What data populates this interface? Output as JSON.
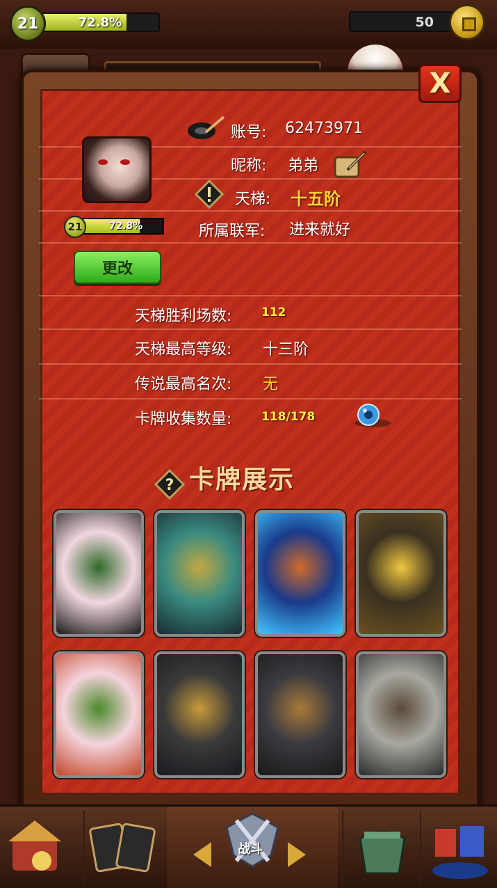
{
  "hud": {
    "level": "21",
    "xp_percent_text": "72.8%",
    "xp_fraction": 0.728,
    "coins": "50"
  },
  "profile": {
    "account_label": "账号:",
    "account_value": "62473971",
    "nickname_label": "昵称:",
    "nickname_value": "弟弟",
    "ladder_label": "天梯:",
    "ladder_value": "十五阶",
    "alliance_label": "所属联军:",
    "alliance_value": "进来就好",
    "level": "21",
    "xp_percent_text": "72.8%",
    "change_button": "更改"
  },
  "stats": {
    "ladder_wins_label": "天梯胜利场数:",
    "ladder_wins_value": "112",
    "ladder_best_label": "天梯最高等级:",
    "ladder_best_value": "十三阶",
    "legend_best_label": "传说最高名次:",
    "legend_best_value": "无",
    "cards_collected_label": "卡牌收集数量:",
    "cards_collected_value": "118/178"
  },
  "showcase": {
    "title": "卡牌展示",
    "cards": [
      {
        "name": "card-warrior-green-robe",
        "colors": [
          "#f2d6e0",
          "#2e6a2a",
          "#1a1a1a"
        ]
      },
      {
        "name": "card-misty-palace",
        "colors": [
          "#3a8a80",
          "#c2a842",
          "#1a2a30"
        ]
      },
      {
        "name": "card-blue-scroll",
        "colors": [
          "#1a3a8a",
          "#d06a2a",
          "#40c8ff"
        ]
      },
      {
        "name": "card-golden-altar",
        "colors": [
          "#3a3020",
          "#f0c840",
          "#6a5020"
        ]
      },
      {
        "name": "card-red-hair-warrior",
        "colors": [
          "#f4d4dc",
          "#4a8a2a",
          "#c2462a"
        ]
      },
      {
        "name": "card-armored-general",
        "colors": [
          "#3a3a3a",
          "#c89a3a",
          "#1a1a20"
        ]
      },
      {
        "name": "card-young-lord",
        "colors": [
          "#3a3a40",
          "#a87a3a",
          "#1a1a1a"
        ]
      },
      {
        "name": "card-battlefield-ruins",
        "colors": [
          "#a8a8a0",
          "#5a4a3a",
          "#2a2a2a"
        ]
      }
    ]
  },
  "close_button": "X",
  "bottom_nav": {
    "battle_label": "战斗"
  }
}
